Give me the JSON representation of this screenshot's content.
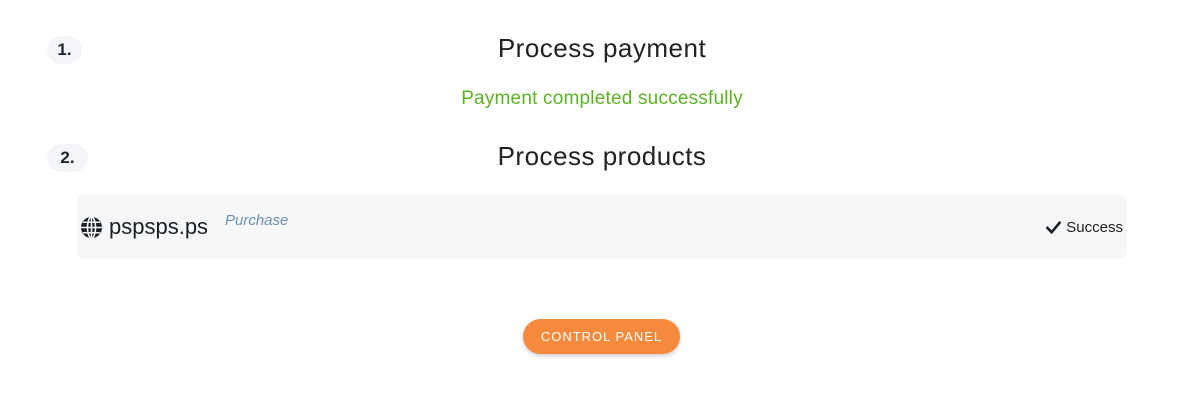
{
  "steps": [
    {
      "number": "1.",
      "title": "Process payment",
      "status": "Payment completed successfully"
    },
    {
      "number": "2.",
      "title": "Process products",
      "products": [
        {
          "icon": "globe-icon",
          "name": "pspsps.ps",
          "type": "Purchase",
          "status_icon": "check-icon",
          "status": "Success"
        }
      ]
    }
  ],
  "actions": {
    "control_panel_label": "CONTROL PANEL"
  },
  "colors": {
    "success_text": "#5cb225",
    "accent_button": "#f58a3d",
    "product_type": "#6d8fb3",
    "row_background": "#f6f7f9",
    "badge_background": "#f4f5f8"
  }
}
